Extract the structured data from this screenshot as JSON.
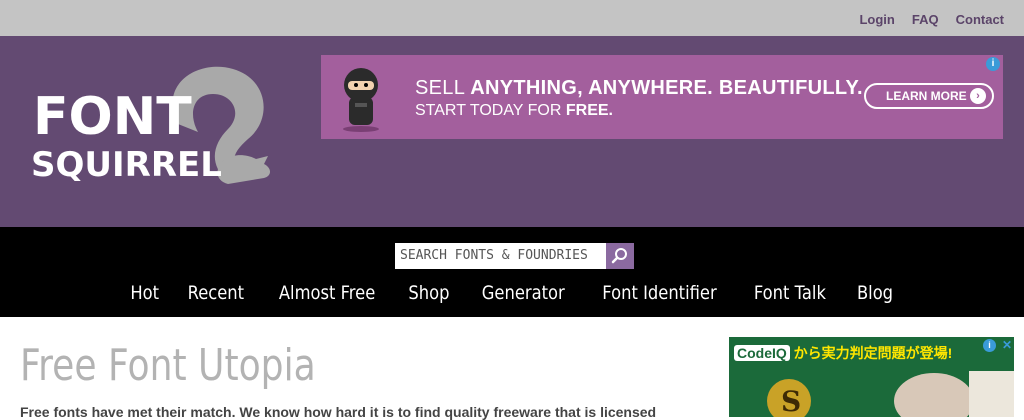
{
  "top_links": {
    "login": "Login",
    "faq": "FAQ",
    "contact": "Contact"
  },
  "logo": {
    "line1": "FONT",
    "line2": "SQUIRREL"
  },
  "banner_ad": {
    "line1_prefix": "SELL ",
    "line1_bold": "ANYTHING, ANYWHERE. BEAUTIFULLY.",
    "line2_prefix": "START TODAY FOR ",
    "line2_bold": "FREE.",
    "cta": "LEARN MORE",
    "info_icon": "i"
  },
  "search": {
    "placeholder": "SEARCH FONTS & FOUNDRIES"
  },
  "nav": {
    "items": [
      "Hot",
      "Recent",
      "Almost Free",
      "Shop",
      "Generator",
      "Font Identifier",
      "Font Talk",
      "Blog"
    ]
  },
  "main": {
    "title": "Free Font Utopia",
    "intro": "Free fonts have met their match. We know how hard it is to find quality freeware that is licensed"
  },
  "side_ad": {
    "brand": "CodeIQ",
    "text": "から実力判定問題が登場!"
  },
  "colors": {
    "header": "#634a72",
    "topbar": "#c4c4c4",
    "ad": "#a35f9d",
    "nav": "#000000",
    "accent": "#8b6aa0"
  }
}
